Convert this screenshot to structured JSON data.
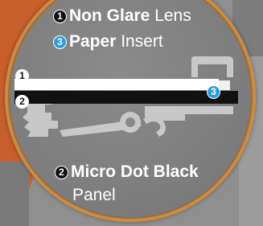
{
  "labels": {
    "item1": {
      "number": "1",
      "bold": "Non Glare",
      "rest": " Lens"
    },
    "item3": {
      "number": "3",
      "bold": "Paper",
      "rest": " Insert"
    },
    "item2": {
      "number": "2",
      "bold": "Micro Dot Black",
      "line2": "Panel"
    }
  },
  "markers": {
    "m1": "1",
    "m2": "2",
    "m3": "3"
  },
  "colors": {
    "magnifier_border": "#c78c45",
    "lens": "#ffffff",
    "panel": "#111111",
    "paper_badge": "#2a9fd8",
    "mechanism": "#c8c8c8"
  }
}
